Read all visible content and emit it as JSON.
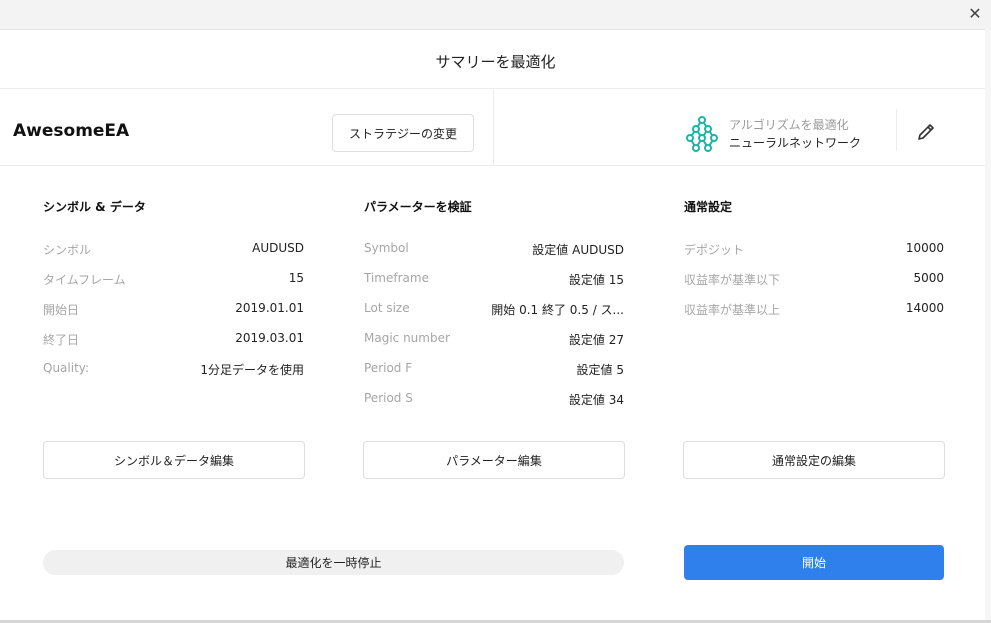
{
  "window": {
    "title": "サマリーを最適化",
    "close_icon": "close-icon"
  },
  "header": {
    "ea_name": "AwesomeEA",
    "change_strategy_label": "ストラテジーの変更",
    "algorithm": {
      "label": "アルゴリズムを最適化",
      "value": "ニューラルネットワーク",
      "icon": "neural-network-icon",
      "icon_color": "#1cb5a3"
    },
    "edit_icon": "pencil-icon"
  },
  "columns": {
    "symbol_data": {
      "title": "シンボル & データ",
      "rows": [
        {
          "label": "シンボル",
          "value": "AUDUSD"
        },
        {
          "label": "タイムフレーム",
          "value": "15"
        },
        {
          "label": "開始日",
          "value": "2019.01.01"
        },
        {
          "label": "終了日",
          "value": "2019.03.01"
        },
        {
          "label": "Quality:",
          "value": "1分足データを使用"
        }
      ],
      "edit_label": "シンボル＆データ編集"
    },
    "parameters": {
      "title": "パラメーターを検証",
      "rows": [
        {
          "label": "Symbol",
          "value": "設定値 AUDUSD"
        },
        {
          "label": "Timeframe",
          "value": "設定値 15"
        },
        {
          "label": "Lot size",
          "value": "開始 0.1 終了 0.5 / ス..."
        },
        {
          "label": "Magic number",
          "value": "設定値 27"
        },
        {
          "label": "Period F",
          "value": "設定値 5"
        },
        {
          "label": "Period S",
          "value": "設定値 34"
        }
      ],
      "edit_label": "パラメーター編集"
    },
    "general": {
      "title": "通常設定",
      "rows": [
        {
          "label": "デポジット",
          "value": "10000"
        },
        {
          "label": "収益率が基準以下",
          "value": "5000"
        },
        {
          "label": "収益率が基準以上",
          "value": "14000"
        }
      ],
      "edit_label": "通常設定の編集"
    }
  },
  "footer": {
    "pause_label": "最適化を一時停止",
    "start_label": "開始",
    "start_color": "#2f80ed"
  }
}
